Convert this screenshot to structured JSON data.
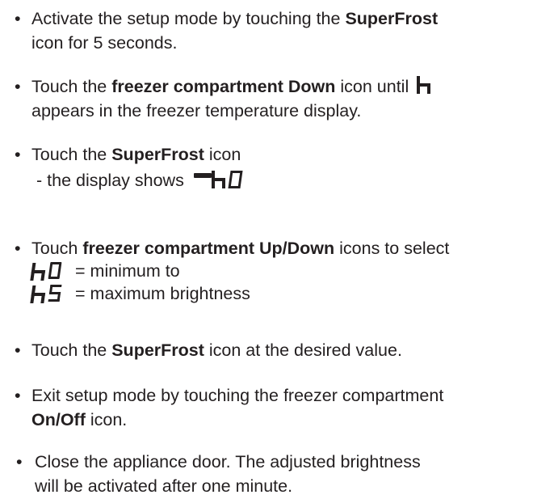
{
  "bullet": "•",
  "items": [
    {
      "pre": "Activate the setup mode by touching the ",
      "bold": "SuperFrost",
      "line2": "icon for 5 seconds."
    },
    {
      "pre": "Touch the ",
      "bold": "freezer compartment Down",
      "post": " icon until",
      "glyph_name": "h-display-icon",
      "line2": "appears in the freezer temperature display."
    },
    {
      "pre": "Touch the ",
      "bold": "SuperFrost",
      "post": " icon",
      "line2": "- the display shows"
    },
    {
      "pre": "Touch ",
      "bold": "freezer compartment Up/Down",
      "post": " icons to select",
      "min_text": "= minimum to",
      "max_text": "= maximum brightness"
    },
    {
      "pre": "Touch the ",
      "bold": "SuperFrost",
      "post": " icon at the desired value."
    },
    {
      "pre": "Exit setup mode by touching the freezer compartment",
      "bold": "On/Off",
      "post": " icon."
    },
    {
      "pre": "Close the appliance door. The adjusted brightness",
      "line2": "will be activated after one minute."
    }
  ],
  "colors": {
    "text": "#231f20",
    "background": "#ffffff"
  }
}
